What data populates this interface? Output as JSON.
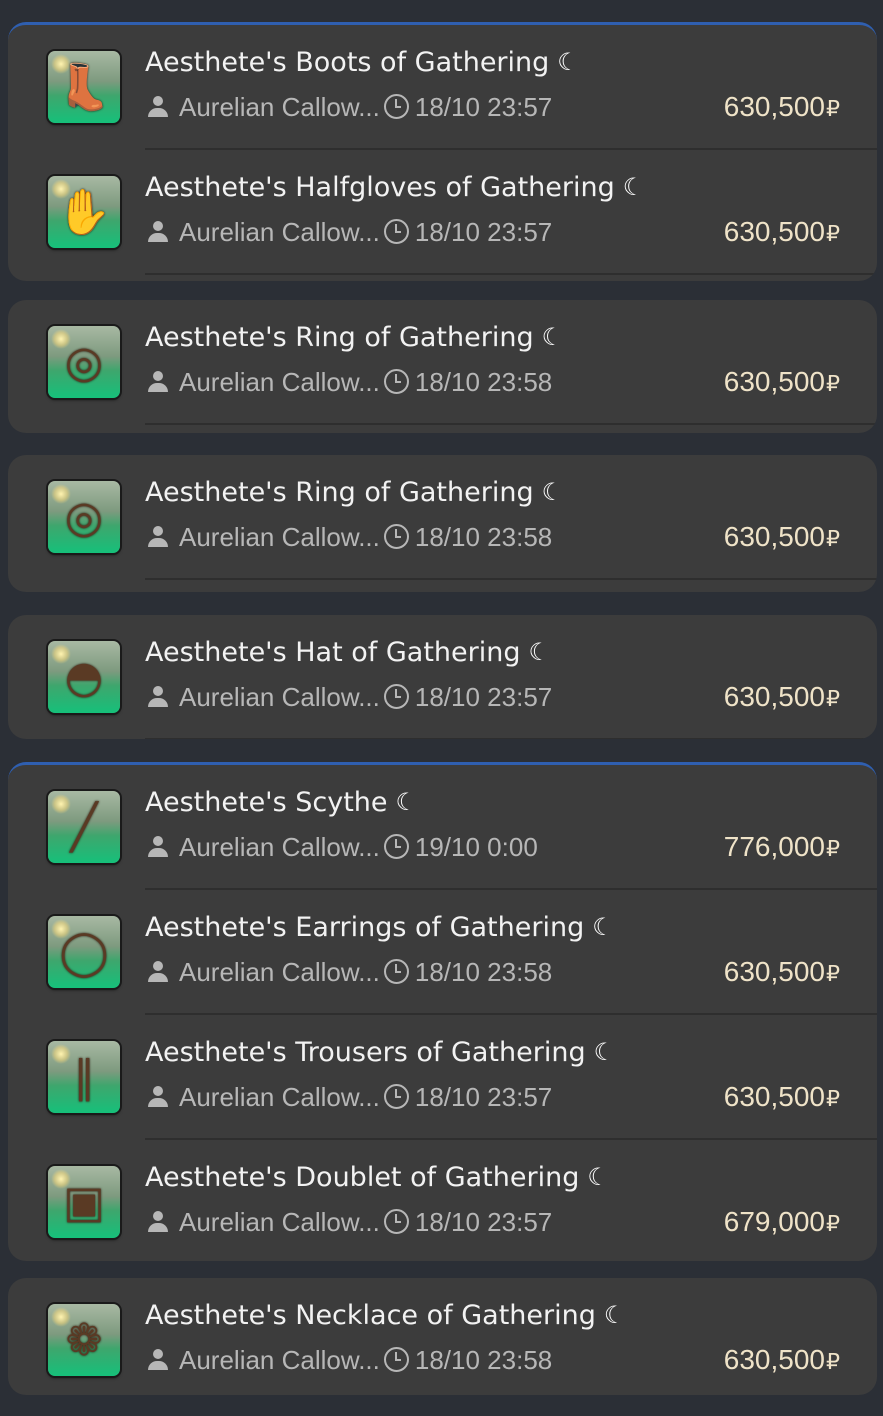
{
  "currency_symbol": "₽",
  "colors": {
    "background": "#2b2f36",
    "card": "#3c3c3c",
    "accent": "#2f5fb0",
    "price": "#efe3c8",
    "meta": "#b7b7b7"
  },
  "groups": [
    {
      "items": [
        {
          "name": "Aesthete's Boots of Gathering",
          "icon": "boots-icon",
          "retainer": "Aurelian Callow...",
          "time": "18/10 23:57",
          "price": "630,500"
        },
        {
          "name": "Aesthete's Halfgloves of Gathering",
          "icon": "gloves-icon",
          "retainer": "Aurelian Callow...",
          "time": "18/10 23:57",
          "price": "630,500"
        }
      ]
    },
    {
      "items": [
        {
          "name": "Aesthete's Ring of Gathering",
          "icon": "ring-icon",
          "retainer": "Aurelian Callow...",
          "time": "18/10 23:58",
          "price": "630,500"
        }
      ]
    },
    {
      "items": [
        {
          "name": "Aesthete's Ring of Gathering",
          "icon": "ring-icon",
          "retainer": "Aurelian Callow...",
          "time": "18/10 23:58",
          "price": "630,500"
        }
      ]
    },
    {
      "items": [
        {
          "name": "Aesthete's Hat of Gathering",
          "icon": "hat-icon",
          "retainer": "Aurelian Callow...",
          "time": "18/10 23:57",
          "price": "630,500"
        }
      ]
    },
    {
      "items": [
        {
          "name": "Aesthete's Scythe",
          "icon": "scythe-icon",
          "retainer": "Aurelian Callow...",
          "time": "19/10 0:00",
          "price": "776,000"
        },
        {
          "name": "Aesthete's Earrings of Gathering",
          "icon": "earrings-icon",
          "retainer": "Aurelian Callow...",
          "time": "18/10 23:58",
          "price": "630,500"
        },
        {
          "name": "Aesthete's Trousers of Gathering",
          "icon": "trousers-icon",
          "retainer": "Aurelian Callow...",
          "time": "18/10 23:57",
          "price": "630,500"
        },
        {
          "name": "Aesthete's Doublet of Gathering",
          "icon": "doublet-icon",
          "retainer": "Aurelian Callow...",
          "time": "18/10 23:57",
          "price": "679,000"
        }
      ]
    },
    {
      "items": [
        {
          "name": "Aesthete's Necklace of Gathering",
          "icon": "necklace-icon",
          "retainer": "Aurelian Callow...",
          "time": "18/10 23:58",
          "price": "630,500"
        }
      ]
    }
  ]
}
